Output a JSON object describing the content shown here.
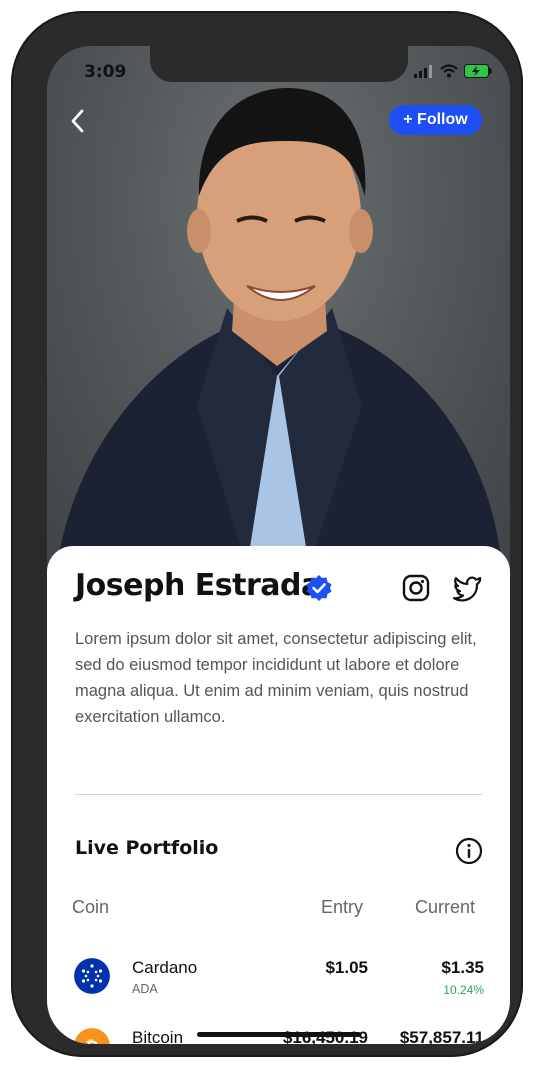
{
  "status_bar": {
    "time": "3:09"
  },
  "header": {
    "follow_label": "+ Follow"
  },
  "profile": {
    "name": "Joseph Estrada",
    "bio": "Lorem ipsum dolor sit amet, consectetur adipiscing elit, sed do eiusmod tempor incididunt ut labore et dolore magna aliqua. Ut enim ad minim veniam, quis nostrud exercitation ullamco."
  },
  "portfolio": {
    "title": "Live Portfolio",
    "columns": {
      "coin": "Coin",
      "entry": "Entry",
      "current": "Current"
    },
    "rows": [
      {
        "name": "Cardano",
        "symbol": "ADA",
        "entry": "$1.05",
        "current": "$1.35",
        "change": "10.24%",
        "logo_color": "#0033ad"
      },
      {
        "name": "Bitcoin",
        "symbol": "",
        "entry": "$16,450.19",
        "current": "$57,857.11",
        "change": "",
        "logo_color": "#f7931a"
      }
    ]
  },
  "colors": {
    "accent": "#1d4ff5",
    "positive": "#2ca94c",
    "verified": "#1d4ff5"
  }
}
